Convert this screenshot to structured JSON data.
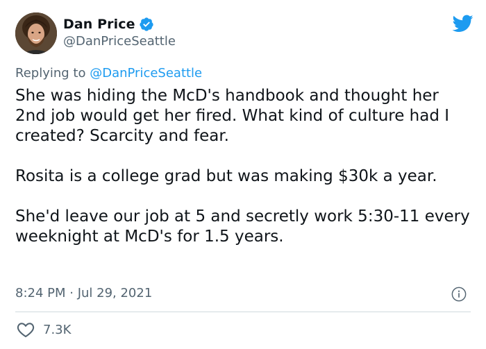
{
  "author": {
    "display_name": "Dan Price",
    "handle": "@DanPriceSeattle",
    "verified": true
  },
  "reply": {
    "prefix": "Replying to ",
    "mention": "@DanPriceSeattle"
  },
  "body": {
    "paragraphs": [
      "She was hiding the McD's handbook and thought her 2nd job would get her fired. What kind of culture had I created? Scarcity and fear.",
      "Rosita is a college grad but was making $30k a year.",
      "She'd leave our job at 5 and secretly work 5:30-11 every weeknight at McD's for 1.5 years."
    ]
  },
  "meta": {
    "timestamp": "8:24 PM · Jul 29, 2021"
  },
  "engagement": {
    "likes": "7.3K"
  },
  "icons": {
    "brand": "twitter-bird-icon",
    "verified": "verified-badge-icon",
    "info": "info-icon",
    "like": "heart-icon"
  },
  "colors": {
    "accent": "#1d9bf0",
    "text_primary": "#0f1419",
    "text_secondary": "#536471",
    "divider": "#cfd9de"
  }
}
